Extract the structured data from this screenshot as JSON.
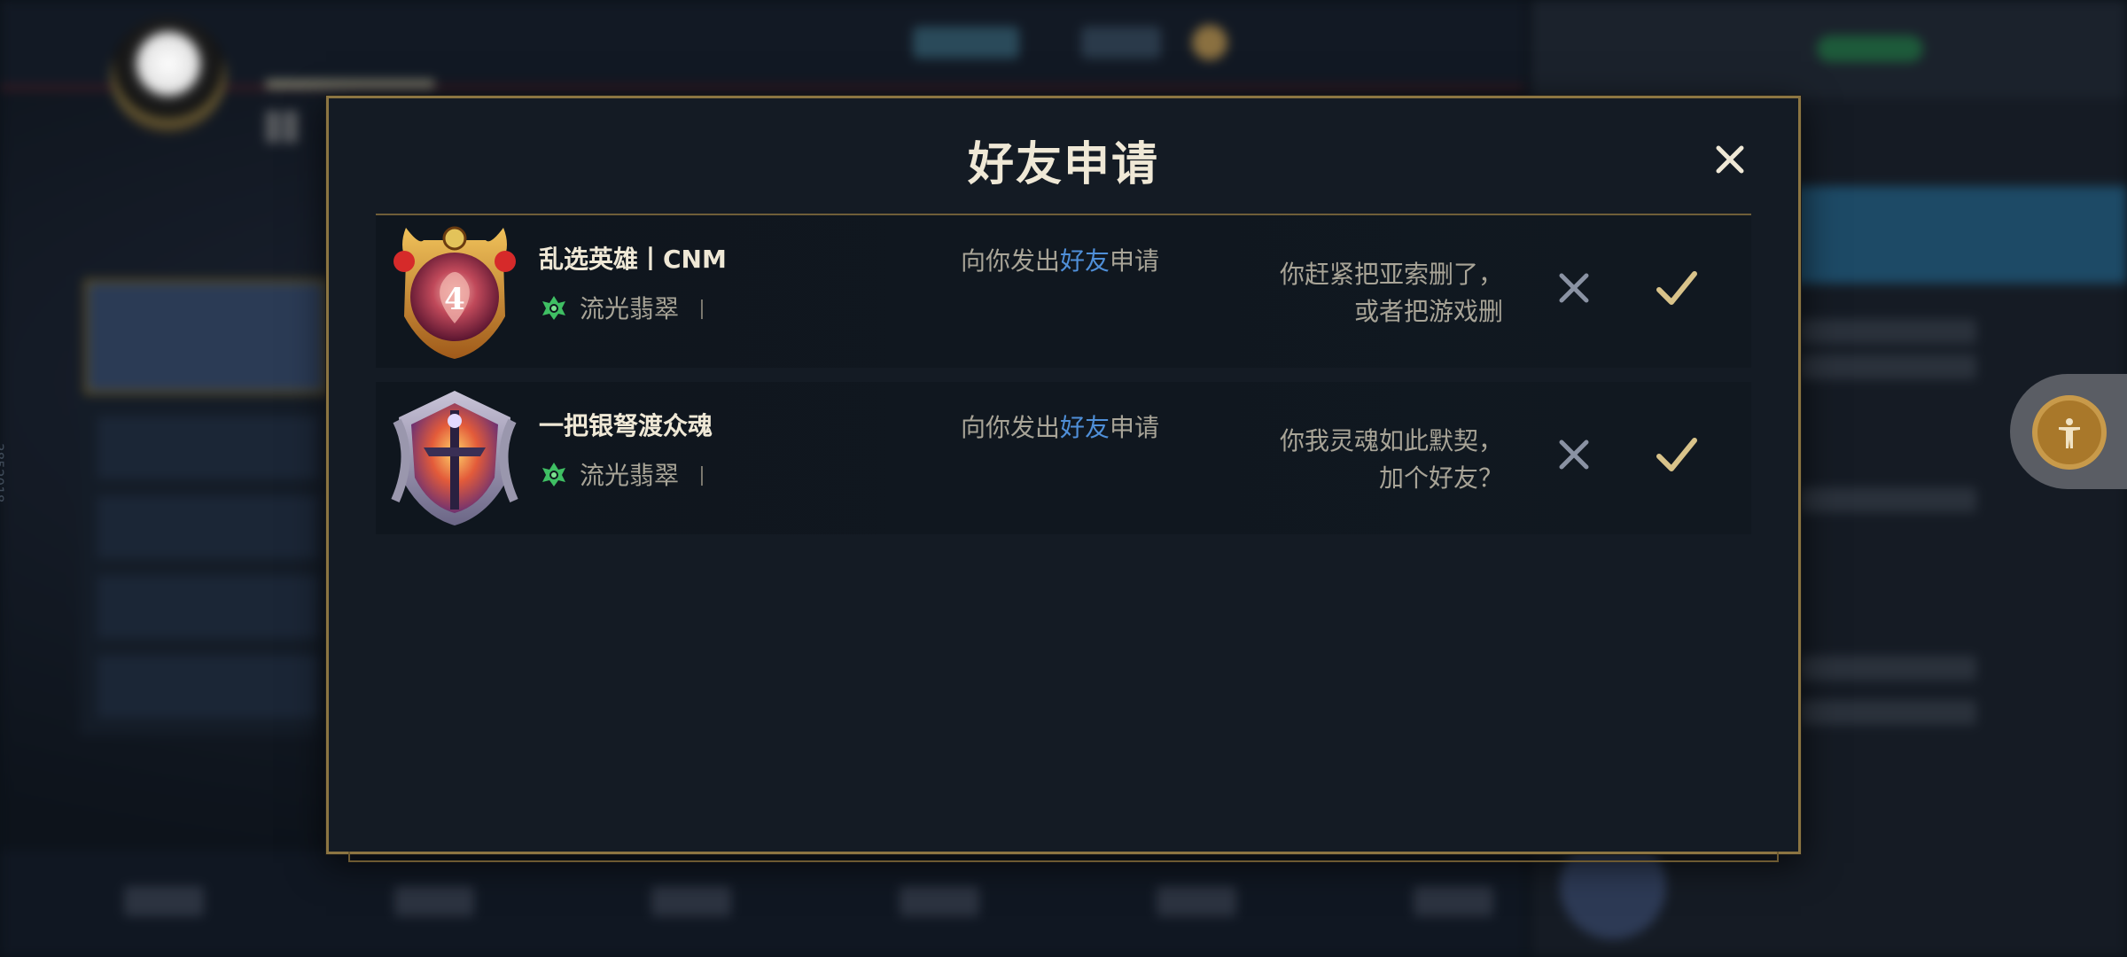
{
  "dialog": {
    "title": "好友申请",
    "close_icon": "close-icon"
  },
  "requests": [
    {
      "player_name": "乱选英雄丨CNM",
      "rank_name": "流光翡翠",
      "rank_separator": "丨",
      "request_prefix": "向你发出",
      "request_highlight": "好友",
      "request_suffix": "申请",
      "message_line1": "你赶紧把亚索删了，",
      "message_line2": "或者把游戏删",
      "badge_level": "4",
      "badge_icon": "rank-badge-red-icon",
      "reject_icon": "reject-x-icon",
      "accept_icon": "accept-check-icon"
    },
    {
      "player_name": "一把银弩渡众魂",
      "rank_name": "流光翡翠",
      "rank_separator": "丨",
      "request_prefix": "向你发出",
      "request_highlight": "好友",
      "request_suffix": "申请",
      "message_line1": "你我灵魂如此默契，",
      "message_line2": "加个好友？",
      "badge_icon": "rank-badge-crossbow-icon",
      "reject_icon": "reject-x-icon",
      "accept_icon": "accept-check-icon"
    }
  ],
  "side_text": "3852018",
  "colors": {
    "gold_border": "#8c7542",
    "highlight_blue": "#4f8fd8",
    "accept_gold": "#d9c38a",
    "reject_grey": "#8a92a3"
  },
  "accessibility_button_icon": "accessibility-icon"
}
